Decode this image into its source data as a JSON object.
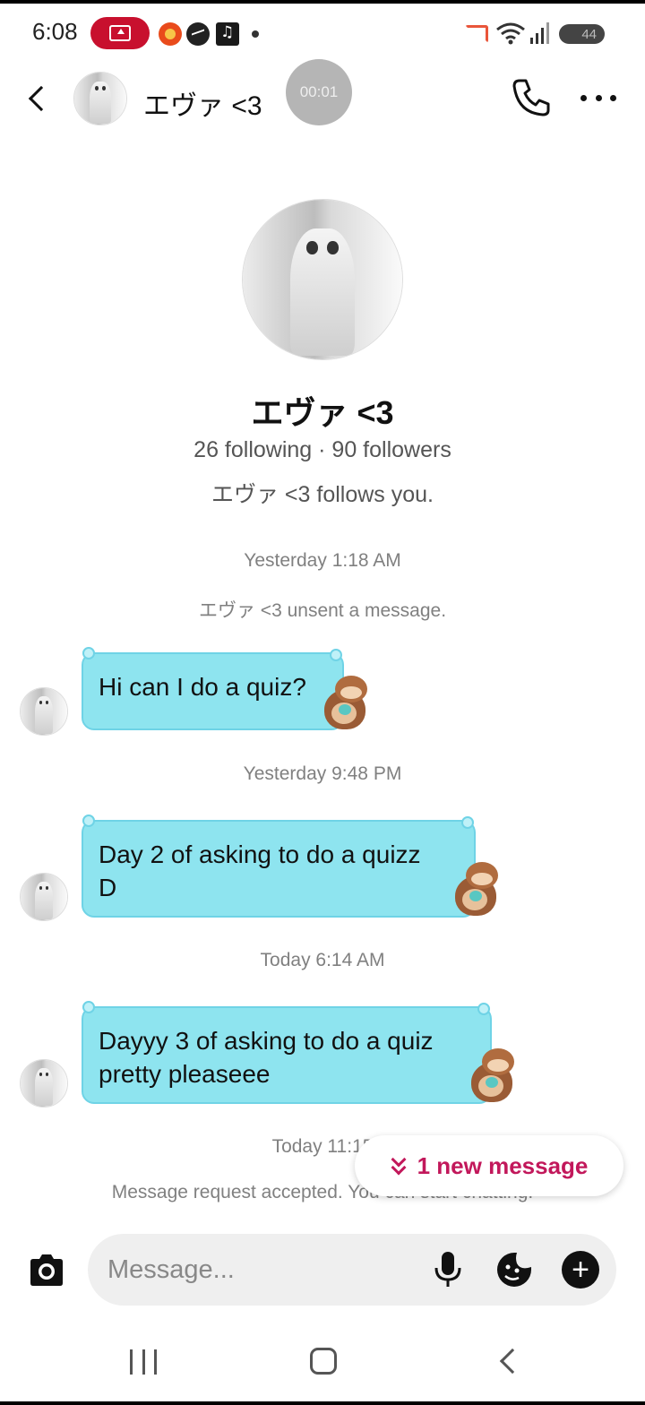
{
  "status_bar": {
    "time": "6:08",
    "battery": "44",
    "icons": [
      "screen-record-icon",
      "app-notification-icon",
      "messenger-icon",
      "music-icon",
      "cast-icon",
      "wifi-icon",
      "signal-icon",
      "battery-icon"
    ]
  },
  "header": {
    "contact_name": "エヴァ <3",
    "call_timer": "00:01",
    "icons": [
      "back-icon",
      "phone-icon",
      "more-icon"
    ]
  },
  "profile": {
    "name": "エヴァ <3",
    "stats": "26 following · 90 followers",
    "follows_you": "エヴァ <3 follows you."
  },
  "conversation": {
    "ts1": "Yesterday 1:18 AM",
    "unsent": "エヴァ <3 unsent a message.",
    "msg1": "Hi can I do a quiz?",
    "ts2": "Yesterday 9:48 PM",
    "msg2_line1": "Day 2 of asking to do a quizz",
    "msg2_line2": "D",
    "ts3": "Today 6:14 AM",
    "msg3_line1": "Dayyy 3 of asking to do a quiz",
    "msg3_line2": "pretty pleaseee",
    "ts4": "Today 11:15",
    "request_accepted": "Message request accepted. You can start chatting."
  },
  "new_message_pill": {
    "label": "1 new message"
  },
  "composer": {
    "placeholder": "Message...",
    "icons": [
      "camera-icon",
      "microphone-icon",
      "sticker-icon",
      "plus-icon"
    ]
  },
  "colors": {
    "bubble": "#8ee4ef",
    "bubble_border": "#6fd3e6",
    "accent": "#c2185b",
    "record_pill": "#c8102e"
  }
}
